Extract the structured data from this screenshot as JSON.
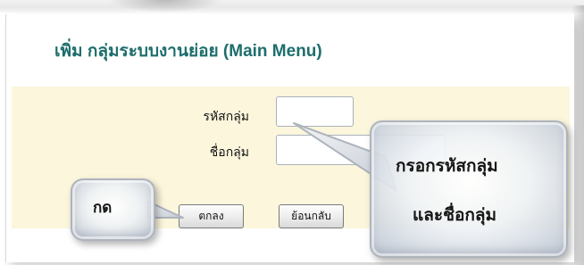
{
  "page": {
    "title": "เพิ่ม กลุ่มระบบงานย่อย (Main Menu)"
  },
  "form": {
    "code_label": "รหัสกลุ่ม",
    "code_value": "",
    "name_label": "ชื่อกลุ่ม",
    "name_value": "",
    "ok_button": "ตกลง",
    "back_button": "ย้อนกลับ"
  },
  "callouts": {
    "press": "กด",
    "fill_line1": "กรอกรหัสกลุ่ม",
    "fill_line2": "และชื่อกลุ่ม"
  },
  "colors": {
    "title": "#1d6e6d",
    "form_background": "#fbf6dc",
    "callout_border": "#aeb4bc"
  }
}
